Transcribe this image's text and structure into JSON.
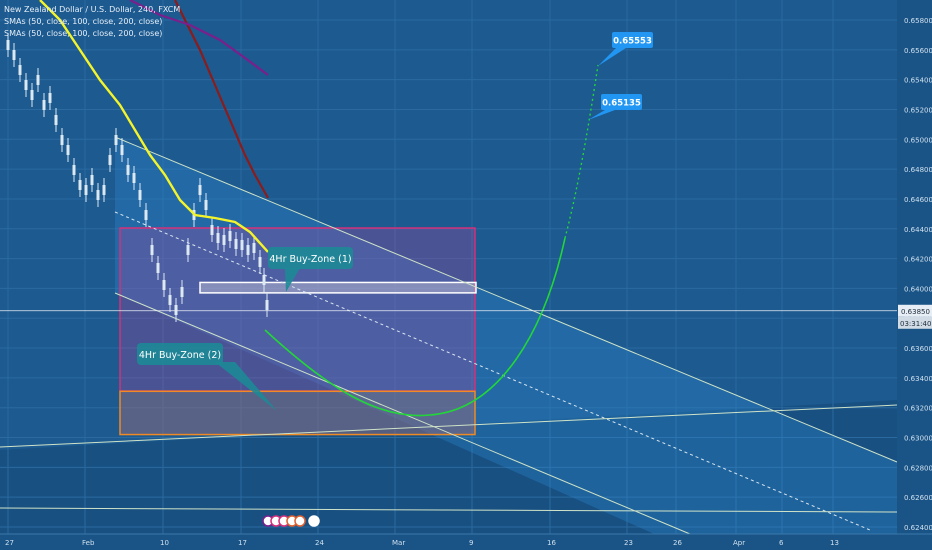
{
  "chart_data": {
    "type": "line",
    "title": "New Zealand Dollar / U.S. Dollar, 240, FXCM",
    "indicators": [
      "SMAs (50, close, 100, close, 200, close)",
      "SMAs (50, close, 100, close, 200, close)"
    ],
    "x_tick_labels": [
      "27",
      "Feb",
      "10",
      "17",
      "24",
      "Mar",
      "9",
      "16",
      "23",
      "26",
      "Apr",
      "6",
      "13"
    ],
    "y_tick_labels": [
      "0.65800",
      "0.65600",
      "0.65400",
      "0.65200",
      "0.65000",
      "0.64800",
      "0.64600",
      "0.64400",
      "0.64200",
      "0.64000",
      "0.63800",
      "0.63600",
      "0.63400",
      "0.63200",
      "0.63000",
      "0.62800",
      "0.62600",
      "0.62400"
    ],
    "ylim": [
      0.624,
      0.658
    ],
    "grid": true,
    "price_label": "0.63850",
    "countdown_label": "03:31:40",
    "targets": [
      {
        "label": "0.65553",
        "value": 0.65553
      },
      {
        "label": "0.65135",
        "value": 0.65135
      }
    ],
    "zones": [
      {
        "label": "4Hr Buy-Zone (1)",
        "low": 0.6397,
        "high": 0.6404
      },
      {
        "label": "4Hr Buy-Zone (2)",
        "low": 0.6302,
        "high": 0.6331
      }
    ],
    "colors": {
      "background": "#1c5a8f",
      "sma50": "#f4f42a",
      "sma100": "#8c1c1c",
      "sma200": "#7a1f8c",
      "projection": "#22d63a",
      "target_box": "#2196f3",
      "zone_callout": "#1d8a96",
      "zone_outer": "#d4307a",
      "zone2_border": "#f08a24"
    }
  }
}
